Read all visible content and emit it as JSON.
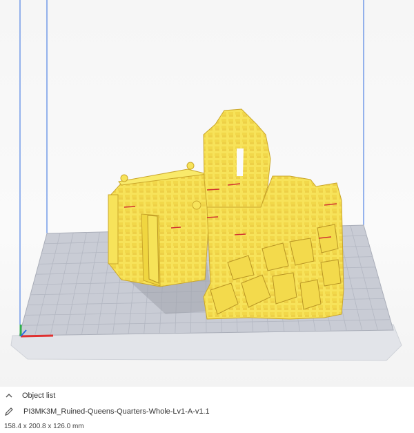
{
  "object_list": {
    "title": "Object list",
    "filename": "PI3MK3M_Ruined-Queens-Quarters-Whole-Lv1-A-v1.1",
    "dimensions": "158.4 x 200.8 x 126.0 mm"
  },
  "colors": {
    "model": "#f7e35a",
    "model_shadow": "#d9bd2c",
    "build_plate": "#c8ccd6",
    "grid_line": "#b0b4bf",
    "volume_edge": "#2f6be0",
    "axis_x": "#e03030",
    "axis_y": "#2f6be0",
    "axis_z": "#2eb04a",
    "overhang": "#d03030"
  },
  "icons": {
    "collapse": "chevron-up-icon",
    "edit": "pencil-icon"
  }
}
